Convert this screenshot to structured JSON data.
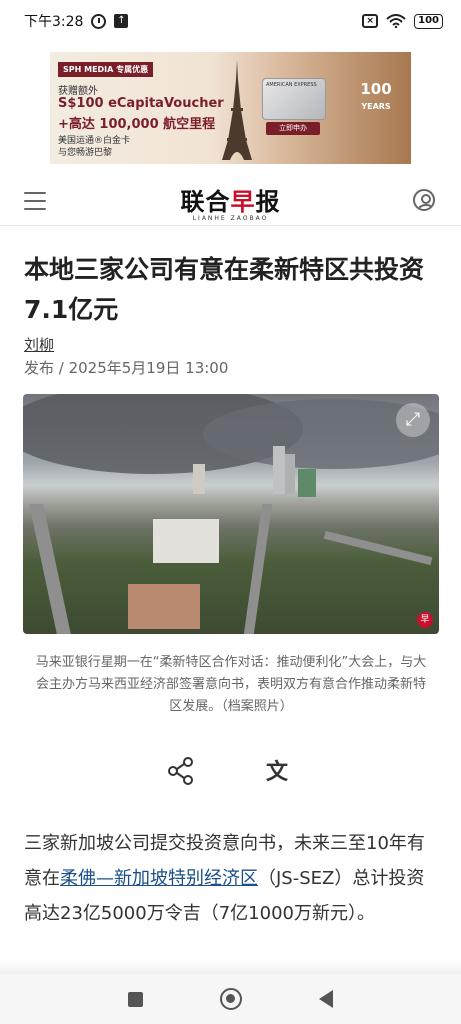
{
  "status": {
    "time": "下午3:28",
    "battery": "100"
  },
  "ad": {
    "sph_tag": "SPH MEDIA 专属优惠",
    "line1": "获赠额外",
    "line2": "S$100 eCapitaVoucher",
    "line3": "+高达 100,000 航空里程",
    "line4": "美国运通®白金卡",
    "line5": "与您畅游巴黎",
    "card_brand": "AMERICAN EXPRESS",
    "cta": "立即申办",
    "anniversary": "100",
    "anniversary_sub": "YEARS"
  },
  "header": {
    "logo_part1": "联合",
    "logo_part2": "早",
    "logo_part3": "报",
    "logo_sub": "LIANHE ZAOBAO"
  },
  "article": {
    "headline": "本地三家公司有意在柔新特区共投资7.1亿元",
    "author": "刘柳",
    "publish": "发布 / 2025年5月19日 13:00",
    "caption": "马来亚银行星期一在“柔新特区合作对话：推动便利化”大会上，与大会主办方马来西亚经济部签署意向书，表明双方有意合作推动柔新特区发展。（档案照片）",
    "body_before_link": "三家新加坡公司提交投资意向书，未来三至10年有意在",
    "body_link": "柔佛—新加坡特别经济区",
    "body_after_link": "（JS-SEZ）总计投资高达23亿5000万令吉（7亿1000万新元）。"
  },
  "icons": {
    "expand": "expand-icon",
    "share": "share-icon",
    "translate": "translate-icon",
    "translate_glyph": "文"
  }
}
